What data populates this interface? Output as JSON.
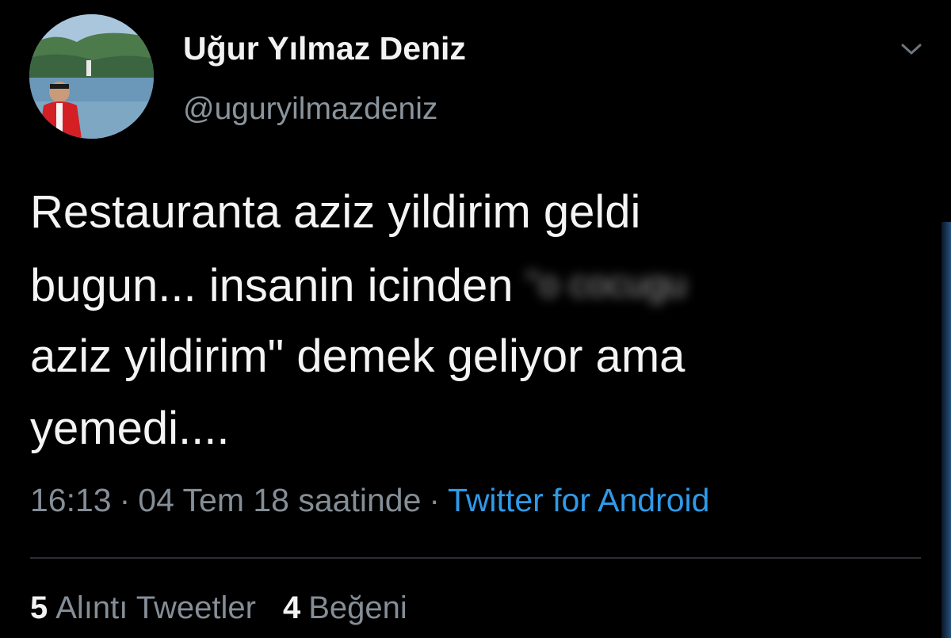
{
  "tweet": {
    "author": {
      "display_name": "Uğur Yılmaz Deniz",
      "handle": "@uguryilmazdeniz",
      "avatar_icon": "profile-photo-avatar"
    },
    "menu_icon": "chevron-down-icon",
    "body_lines": [
      "Restauranta aziz yildirim geldi",
      "bugun... insanin icinden",
      "aziz yildirim\" demek geliyor ama",
      "yemedi...."
    ],
    "blurred_text": "\"o cocugu",
    "meta": {
      "time": "16:13",
      "separator": "·",
      "date": "04 Tem 18 saatinde",
      "source": "Twitter for Android"
    },
    "stats": [
      {
        "count": "5",
        "label": "Alıntı Tweetler"
      },
      {
        "count": "4",
        "label": "Beğeni"
      }
    ],
    "colors": {
      "background": "#000000",
      "link": "#2f9ae8",
      "muted": "#858e97"
    }
  }
}
